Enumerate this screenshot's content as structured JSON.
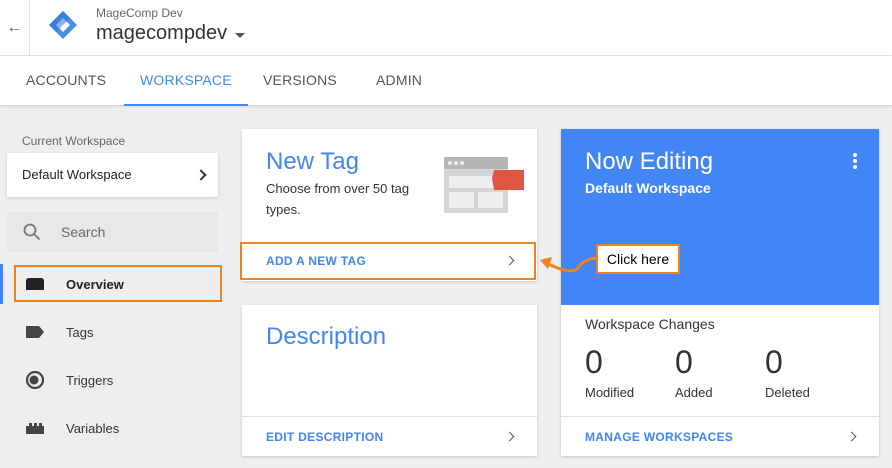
{
  "header": {
    "account_small": "MageComp Dev",
    "account_name": "magecompdev"
  },
  "nav": {
    "tabs": [
      {
        "label": "ACCOUNTS"
      },
      {
        "label": "WORKSPACE"
      },
      {
        "label": "VERSIONS"
      },
      {
        "label": "ADMIN"
      }
    ],
    "active": "WORKSPACE"
  },
  "sidebar": {
    "current_workspace_label": "Current Workspace",
    "workspace_name": "Default Workspace",
    "search_placeholder": "Search",
    "items": [
      {
        "label": "Overview",
        "icon": "folder-icon"
      },
      {
        "label": "Tags",
        "icon": "tag-icon"
      },
      {
        "label": "Triggers",
        "icon": "trigger-icon"
      },
      {
        "label": "Variables",
        "icon": "variable-icon"
      }
    ]
  },
  "new_tag_card": {
    "title": "New Tag",
    "subtitle": "Choose from over 50 tag types.",
    "link": "ADD A NEW TAG"
  },
  "description_card": {
    "title": "Description",
    "link": "EDIT DESCRIPTION"
  },
  "now_editing_card": {
    "title": "Now Editing",
    "workspace": "Default Workspace",
    "changes_title": "Workspace Changes",
    "stats": [
      {
        "value": "0",
        "label": "Modified"
      },
      {
        "value": "0",
        "label": "Added"
      },
      {
        "value": "0",
        "label": "Deleted"
      }
    ],
    "link": "MANAGE WORKSPACES"
  },
  "annotation": {
    "callout_text": "Click here"
  },
  "colors": {
    "accent": "#4285f4",
    "highlight": "#f0821e"
  }
}
